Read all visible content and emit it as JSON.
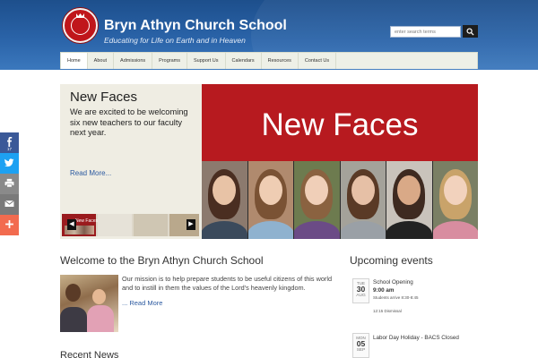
{
  "header": {
    "title": "Bryn Athyn Church School",
    "tagline": "Educating for Life on Earth and in Heaven",
    "search_placeholder": "enter search terms"
  },
  "nav": {
    "items": [
      "Home",
      "About",
      "Admissions",
      "Programs",
      "Support Us",
      "Calendars",
      "Resources",
      "Contact Us"
    ],
    "active": "Home"
  },
  "share_bar": [
    {
      "icon": "facebook-icon",
      "color": "#3b5998",
      "count": "17"
    },
    {
      "icon": "twitter-icon",
      "color": "#1da1f2"
    },
    {
      "icon": "print-icon",
      "color": "#8a8a8a"
    },
    {
      "icon": "email-icon",
      "color": "#7a7a7a"
    },
    {
      "icon": "plus-icon",
      "color": "#f26b4f"
    }
  ],
  "slider": {
    "title": "New Faces",
    "text": "We are excited to be welcoming six new teachers to our faculty next year.",
    "more": "Read More...",
    "thumb_label": "New Faces",
    "banner_text": "New Faces",
    "banner_color": "#b71a1f"
  },
  "welcome": {
    "title": "Welcome to the Bryn Athyn Church School",
    "text": "Our mission is to help prepare students to be useful citizens of this world and to instill in them the values of the Lord's heavenly kingdom.",
    "more": "... Read More"
  },
  "recent_news": {
    "title": "Recent News"
  },
  "events": {
    "title": "Upcoming events",
    "items": [
      {
        "dow": "TUE",
        "day": "30",
        "month": "AUG",
        "title": "School Opening",
        "time": "9:00 am",
        "note1": "Students arrive 8:30-8:45",
        "note2": "12:15 Dismissal"
      },
      {
        "dow": "MON",
        "day": "05",
        "month": "SEP",
        "title": "Labor Day Holiday - BACS Closed"
      }
    ]
  },
  "colors": {
    "header_blue": "#2a63a8",
    "link_blue": "#2c5aa0",
    "accent_red": "#b71a1f"
  }
}
